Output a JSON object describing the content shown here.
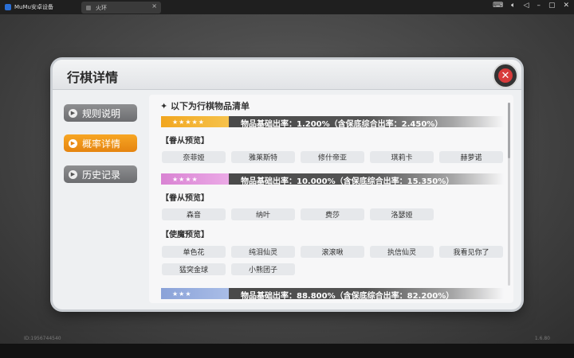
{
  "window": {
    "app_name": "MuMu安卓设备",
    "tab_name": "火环",
    "icons": [
      "keyboard-icon",
      "volume-icon",
      "back-icon",
      "minimize-icon",
      "restore-icon",
      "close-icon"
    ]
  },
  "footer": {
    "uid": "ID:1956744540",
    "version": "1.6.80"
  },
  "dialog": {
    "title": "行棋详情",
    "heading": "以下为行棋物品清单",
    "sidebar": [
      {
        "label": "规则说明",
        "active": false
      },
      {
        "label": "概率详情",
        "active": true
      },
      {
        "label": "历史记录",
        "active": false
      }
    ],
    "tiers": [
      {
        "stars": "★★★★★",
        "rate_text": "物品基础出率：1.200%（含保底综合出率：2.450%）",
        "groups": [
          {
            "title": "【眷从预览】",
            "items": [
              "奈菲娅",
              "雅莱斯特",
              "修什帝亚",
              "琪莉卡",
              "赫萝诺"
            ]
          }
        ]
      },
      {
        "stars": "★★★★",
        "rate_text": "物品基础出率：10.000%（含保底综合出率：15.350%）",
        "groups": [
          {
            "title": "【眷从预览】",
            "items": [
              "森音",
              "纳叶",
              "费莎",
              "洛瑟娅"
            ]
          },
          {
            "title": "【使魔预览】",
            "items": [
              "单色花",
              "纯泪仙灵",
              "滚滚啾",
              "执信仙灵",
              "我看见你了",
              "猛突金球",
              "小熊团子"
            ]
          }
        ]
      },
      {
        "stars": "★★★",
        "rate_text": "物品基础出率：88.800%（含保底综合出率：82.200%）",
        "groups": []
      }
    ]
  },
  "colors": {
    "accent": "#f0a020",
    "close_red": "#d83b3b",
    "tier5": "#f1a61f",
    "tier4": "#d983d3",
    "tier3": "#8aa2d8"
  }
}
